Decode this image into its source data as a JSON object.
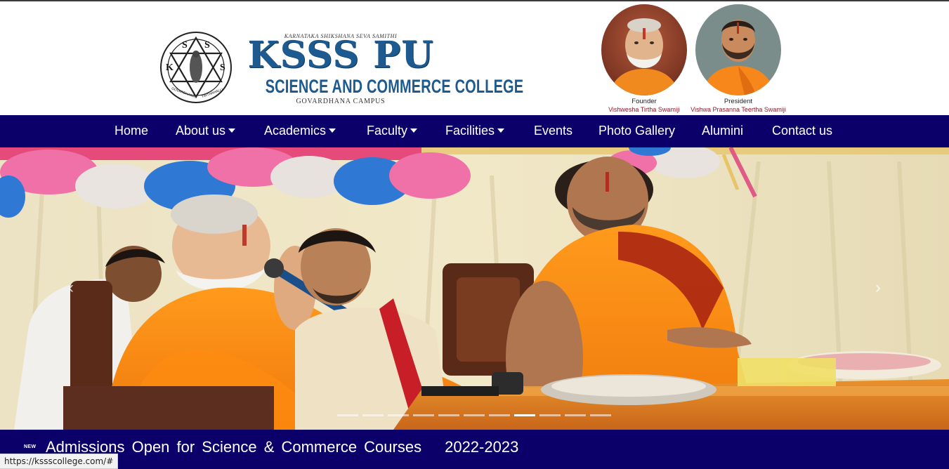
{
  "header": {
    "society": "KARNATAKA SHIKSHANA SEVA SAMITHI",
    "college_main": "KSSS PU",
    "college_sub": "SCIENCE AND COMMERCE COLLEGE",
    "campus": "GOVARDHANA CAMPUS",
    "emblem_letters": [
      "S",
      "S",
      "K",
      "S"
    ],
    "emblem_ring": [
      "GOVARDHANA",
      "TIRTHAHALLI"
    ],
    "people": [
      {
        "role": "Founder",
        "name": "Vishwesha Tirtha Swamiji"
      },
      {
        "role": "President",
        "name": "Vishwa Prasanna Teertha Swamiji"
      }
    ]
  },
  "nav": {
    "items": [
      {
        "label": "Home",
        "dropdown": false
      },
      {
        "label": "About us",
        "dropdown": true
      },
      {
        "label": "Academics",
        "dropdown": true
      },
      {
        "label": "Faculty",
        "dropdown": true
      },
      {
        "label": "Facilities",
        "dropdown": true
      },
      {
        "label": "Events",
        "dropdown": false
      },
      {
        "label": "Photo Gallery",
        "dropdown": false
      },
      {
        "label": "Alumini",
        "dropdown": false
      },
      {
        "label": "Contact us",
        "dropdown": false
      }
    ]
  },
  "carousel": {
    "prev_icon": "chevron-left-icon",
    "next_icon": "chevron-right-icon",
    "indicator_count": 11,
    "active_index": 7
  },
  "news": {
    "badge": "NEW",
    "text": "Admissions Open for Science & Commerce Courses",
    "year": "2022-2023"
  },
  "status_bar": {
    "url": "https://kssscollege.com/#"
  },
  "colors": {
    "nav_bg": "#0b0069",
    "logo_blue": "#1d5a8f",
    "name_red": "#8a1b2a",
    "robe_orange": "#f7871b"
  }
}
